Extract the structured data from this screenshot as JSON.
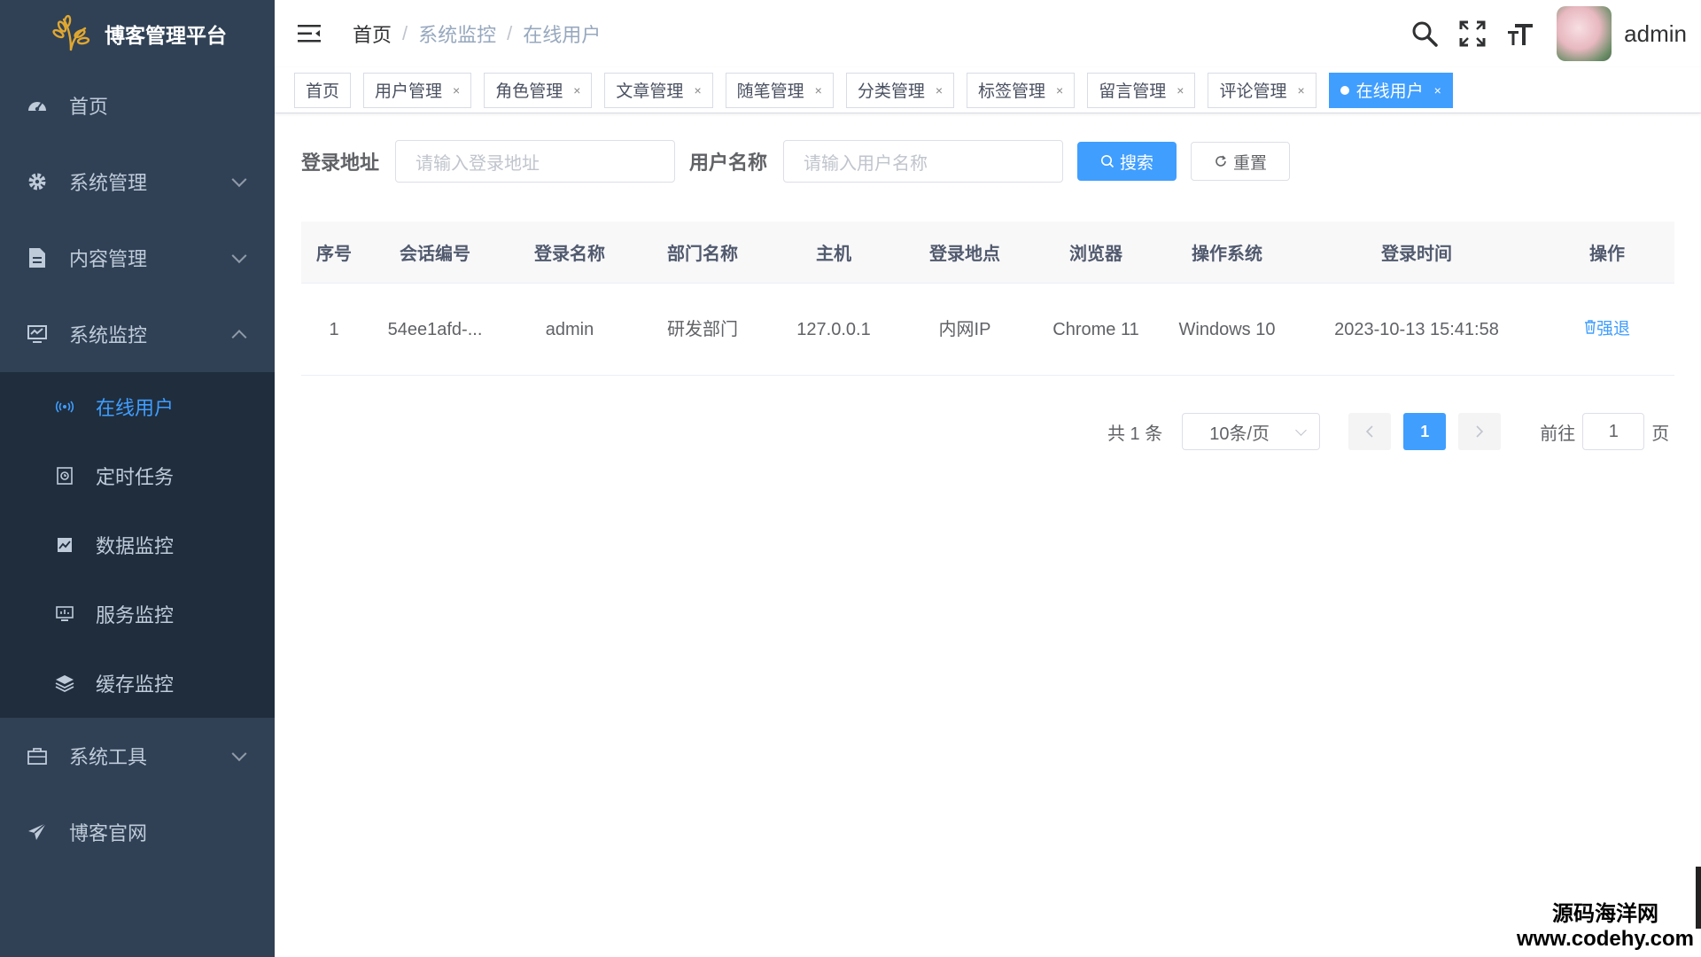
{
  "sidebar": {
    "logo_title": "博客管理平台",
    "menu": [
      {
        "label": "首页",
        "icon": "dashboard-icon"
      },
      {
        "label": "系统管理",
        "icon": "gear-icon"
      },
      {
        "label": "内容管理",
        "icon": "document-icon"
      },
      {
        "label": "系统监控",
        "icon": "monitor-icon"
      }
    ],
    "submenu": [
      {
        "label": "在线用户",
        "icon": "online-icon"
      },
      {
        "label": "定时任务",
        "icon": "timer-icon"
      },
      {
        "label": "数据监控",
        "icon": "data-icon"
      },
      {
        "label": "服务监控",
        "icon": "server-icon"
      },
      {
        "label": "缓存监控",
        "icon": "cache-icon"
      }
    ],
    "menu_bottom": [
      {
        "label": "系统工具",
        "icon": "toolbox-icon"
      },
      {
        "label": "博客官网",
        "icon": "send-icon"
      }
    ]
  },
  "header": {
    "breadcrumb": [
      "首页",
      "系统监控",
      "在线用户"
    ],
    "breadcrumb_sep": "/",
    "username": "admin"
  },
  "tags": [
    {
      "label": "首页"
    },
    {
      "label": "用户管理"
    },
    {
      "label": "角色管理"
    },
    {
      "label": "文章管理"
    },
    {
      "label": "随笔管理"
    },
    {
      "label": "分类管理"
    },
    {
      "label": "标签管理"
    },
    {
      "label": "留言管理"
    },
    {
      "label": "评论管理"
    },
    {
      "label": "在线用户"
    }
  ],
  "tag_close": "×",
  "search": {
    "ipaddr_label": "登录地址",
    "ipaddr_placeholder": "请输入登录地址",
    "username_label": "用户名称",
    "username_placeholder": "请输入用户名称",
    "search_button": "搜索",
    "reset_button": "重置"
  },
  "table": {
    "columns": [
      "序号",
      "会话编号",
      "登录名称",
      "部门名称",
      "主机",
      "登录地点",
      "浏览器",
      "操作系统",
      "登录时间",
      "操作"
    ],
    "rows": [
      {
        "index": "1",
        "token": "54ee1afd-...",
        "user": "admin",
        "dept": "研发部门",
        "host": "127.0.0.1",
        "location": "内网IP",
        "browser": "Chrome 11",
        "os": "Windows 10",
        "time": "2023-10-13 15:41:58",
        "action": "强退"
      }
    ]
  },
  "pagination": {
    "total": "共 1 条",
    "page_size": "10条/页",
    "current_page": "1",
    "goto_prefix": "前往",
    "goto_value": "1",
    "goto_suffix": "页"
  },
  "watermark": {
    "line1": "源码海洋网",
    "line2": "www.codehy.com"
  },
  "colors": {
    "sidebar_bg": "#304156",
    "submenu_bg": "#1f2d3d",
    "primary": "#409eff"
  }
}
